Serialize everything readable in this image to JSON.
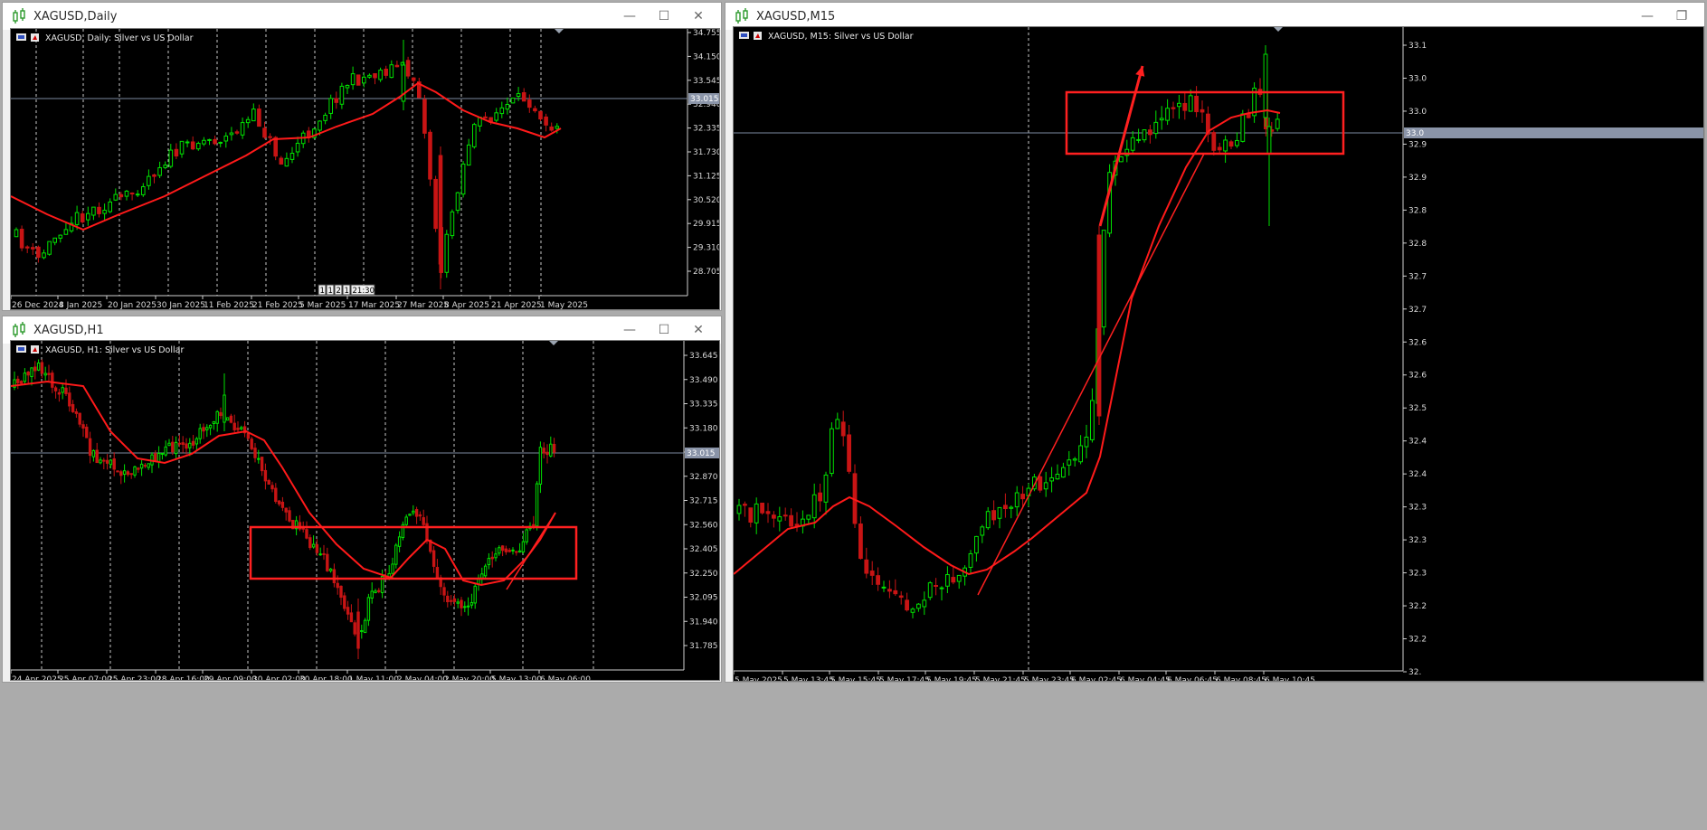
{
  "colors": {
    "bull": "#00e100",
    "bear": "#c81414",
    "ma": "#ff1a1a",
    "box": "#ff2020",
    "grid": "#c8c8c8",
    "axis_text": "#d8d8d8",
    "bid_line": "#7d8aa0"
  },
  "window_buttons": {
    "minimize": "—",
    "maximize": "☐",
    "close": "✕",
    "restore": "❐"
  },
  "windows": [
    {
      "id": "daily",
      "title": "XAGUSD,Daily",
      "chart_label": "XAGUSD, Daily:  Silver vs US Dollar",
      "price_labels": [
        "34.755",
        "34.150",
        "33.545",
        "32.940",
        "32.335",
        "31.730",
        "31.125",
        "30.520",
        "29.915",
        "29.310",
        "28.705"
      ],
      "current_price": "33.015",
      "time_labels": [
        "26 Dec 2024",
        "8 Jan 2025",
        "20 Jan 2025",
        "30 Jan 2025",
        "11 Feb 2025",
        "21 Feb 2025",
        "5 Mar 2025",
        "17 Mar 2025",
        "27 Mar 2025",
        "8 Apr 2025",
        "21 Apr 2025",
        "1 May 2025"
      ],
      "countdown": [
        "1",
        "1",
        "2",
        "1",
        "21:30"
      ]
    },
    {
      "id": "h1",
      "title": "XAGUSD,H1",
      "chart_label": "XAGUSD, H1:  Silver vs US Dollar",
      "price_labels": [
        "33.645",
        "33.490",
        "33.335",
        "33.180",
        "33.025",
        "32.870",
        "32.715",
        "32.560",
        "32.405",
        "32.250",
        "32.095",
        "31.940",
        "31.785"
      ],
      "current_price": "33.015",
      "time_labels": [
        "24 Apr 2025",
        "25 Apr 07:00",
        "25 Apr 23:00",
        "28 Apr 16:00",
        "29 Apr 09:00",
        "30 Apr 02:00",
        "30 Apr 18:00",
        "1 May 11:00",
        "2 May 04:00",
        "2 May 20:00",
        "5 May 13:00",
        "6 May 06:00"
      ]
    },
    {
      "id": "m15",
      "title": "XAGUSD,M15",
      "chart_label": "XAGUSD, M15:  Silver vs US Dollar",
      "price_labels": [
        "33.1",
        "33.0",
        "33.0",
        "32.9",
        "32.9",
        "32.8",
        "32.8",
        "32.7",
        "32.7",
        "32.6",
        "32.6",
        "32.5",
        "32.4",
        "32.4",
        "32.3",
        "32.3",
        "32.3",
        "32.2",
        "32.2",
        "32."
      ],
      "current_price": "33.0",
      "time_labels": [
        "5 May 2025",
        "5 May 13:45",
        "5 May 15:45",
        "5 May 17:45",
        "5 May 19:45",
        "5 May 21:45",
        "5 May 23:45",
        "6 May 02:45",
        "6 May 04:45",
        "6 May 06:45",
        "6 May 08:45",
        "6 May 10:45"
      ]
    }
  ]
}
